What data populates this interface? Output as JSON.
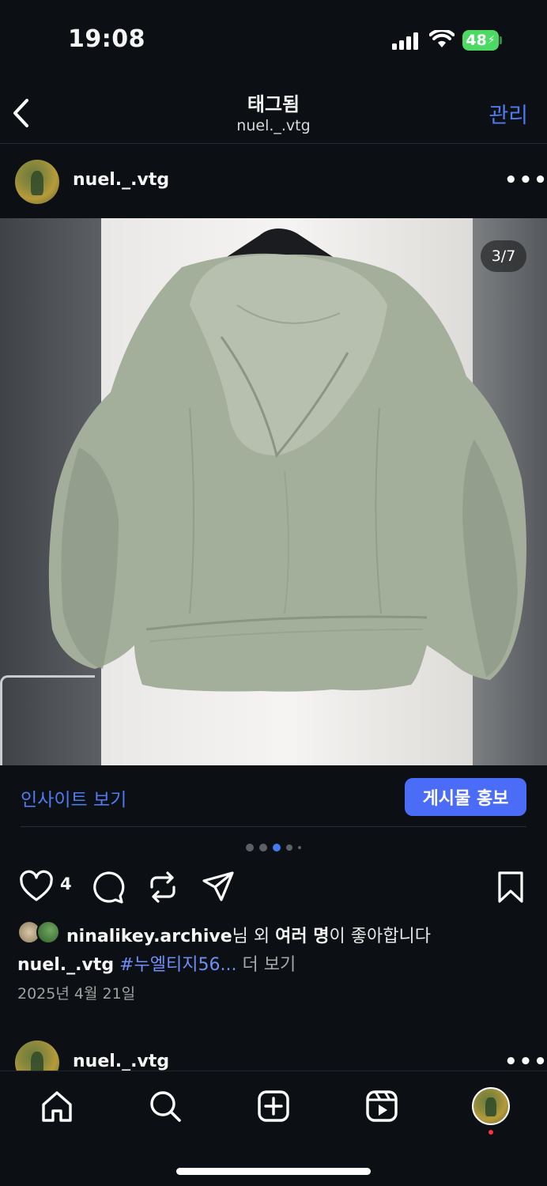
{
  "status_bar": {
    "time": "19:08",
    "battery": "48",
    "icons": [
      "cellular-signal-icon",
      "wifi-icon",
      "battery-charging-icon"
    ]
  },
  "nav": {
    "title": "태그됨",
    "subtitle": "nuel._.vtg",
    "manage_label": "관리",
    "icons": [
      "back-chevron-icon"
    ]
  },
  "post": {
    "username": "nuel._.vtg",
    "image_counter": "3/7",
    "insights_label": "인사이트 보기",
    "promote_label": "게시물 홍보",
    "carousel": {
      "total_dots": 5,
      "active_index": 2
    },
    "like_count": "4",
    "liked_by_user": "ninalikey.archive",
    "liked_by_suffix_1": "님 외 ",
    "liked_by_bold": "여러 명",
    "liked_by_suffix_2": "이 좋아합니다",
    "caption_user": "nuel._.vtg",
    "caption_hashtag": "#누엘티지56...",
    "caption_more": "더 보기",
    "date": "2025년 4월 21일",
    "icons": [
      "more-icon",
      "heart-icon",
      "comment-icon",
      "repost-icon",
      "share-icon",
      "bookmark-icon"
    ]
  },
  "next_post": {
    "username": "nuel._.vtg"
  },
  "tab_bar": {
    "items": [
      "home-icon",
      "search-icon",
      "create-icon",
      "reels-icon",
      "profile-avatar"
    ]
  },
  "colors": {
    "background": "#0c1014",
    "accent_blue": "#4f7bf0",
    "promote_button": "#4a6cf7",
    "battery_green": "#4cd964",
    "notification_dot": "#ff3040"
  }
}
